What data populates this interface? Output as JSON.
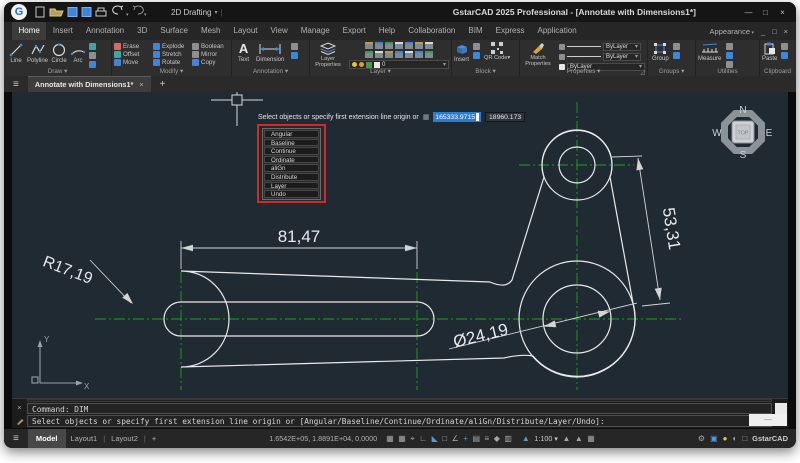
{
  "titlebar": {
    "title": "GstarCAD 2025 Professional - [Annotate with Dimensions1*]",
    "workspace": "2D Drafting"
  },
  "window_controls": {
    "minimize": "—",
    "restore": "□",
    "close": "×"
  },
  "mdi_controls": {
    "appearance": "Appearance",
    "caret": "▾",
    "minimize": "_",
    "restore": "□",
    "close": "×"
  },
  "ribbon_tabs": [
    "Home",
    "Insert",
    "Annotation",
    "3D",
    "Surface",
    "Mesh",
    "Layout",
    "View",
    "Manage",
    "Export",
    "Help",
    "Collaboration",
    "BIM",
    "Express",
    "Application"
  ],
  "panels": {
    "draw": {
      "label": "Draw ▾",
      "items": [
        "Line",
        "Polyline",
        "Circle",
        "Arc"
      ]
    },
    "modify": {
      "label": "Modify ▾",
      "items": [
        "Erase",
        "Explode",
        "Boolean",
        "Offset",
        "Stretch",
        "Mirror",
        "Move",
        "Rotate",
        "Copy"
      ]
    },
    "annotation": {
      "label": "Annotation ▾",
      "big_a": "A",
      "text": "Text",
      "dimension": "Dimension"
    },
    "layer": {
      "label": "Layer ▾",
      "properties": "Layer Properties",
      "current": "0"
    },
    "block": {
      "label": "Block ▾",
      "insert": "Insert",
      "qr": "QR Code▾"
    },
    "properties": {
      "label": "Properties ▾",
      "match": "Match Properties",
      "bylayer1": "ByLayer",
      "bylayer2": "ByLayer",
      "bylayer3": "ByLayer"
    },
    "groups": {
      "label": "Groups ▾",
      "group": "Group"
    },
    "utilities": {
      "label": "Utilities",
      "measure": "Measure"
    },
    "clipboard": {
      "label": "Clipboard",
      "paste": "Paste"
    }
  },
  "document_tabs": {
    "active": "Annotate with Dimensions1*",
    "close": "×",
    "new": "+",
    "menu": "≡"
  },
  "drawing": {
    "prompt": "Select objects or specify first extension line origin or",
    "coord_x": "165333.9715",
    "coord_y": "18960.173",
    "context_menu": [
      "Angular",
      "Baseline",
      "Continue",
      "Ordinate",
      "aliGn",
      "Distribute",
      "Layer",
      "Undo"
    ],
    "dim_length": "81,47",
    "dim_aligned": "53,31",
    "dim_radius": "R17,19",
    "dim_diameter": "Ø24,19",
    "navcube": {
      "n": "N",
      "e": "E",
      "s": "S",
      "w": "W",
      "top": "TOP"
    },
    "ucs": {
      "x": "X",
      "y": "Y"
    }
  },
  "command": {
    "line1": "Command: DIM",
    "line2": "Select objects or specify first extension line origin or [Angular/Baseline/Continue/Ordinate/aliGn/Distribute/Layer/Undo]:",
    "close": "×",
    "expand": "—"
  },
  "status": {
    "menu": "≡",
    "model": "Model",
    "layout1": "Layout1",
    "layout2": "Layout2",
    "sep": "|",
    "add": "+",
    "coords": "1.6542E+05, 1.8891E+04, 0.0000",
    "mid_icons": [
      "▦",
      "▦",
      "⌖",
      "∟",
      "◣",
      "□",
      "∠",
      "+",
      "▤",
      "≡",
      "◆",
      "▥"
    ],
    "scale": "1:100 ▾",
    "brand": "GstarCAD"
  },
  "colors": {
    "accent_blue": "#3f86d8",
    "highlight_blue": "#2e7cd0",
    "centerline_green": "#1ca01c",
    "annotation_red": "#d22b21",
    "canvas_bg": "#1f2a33"
  }
}
